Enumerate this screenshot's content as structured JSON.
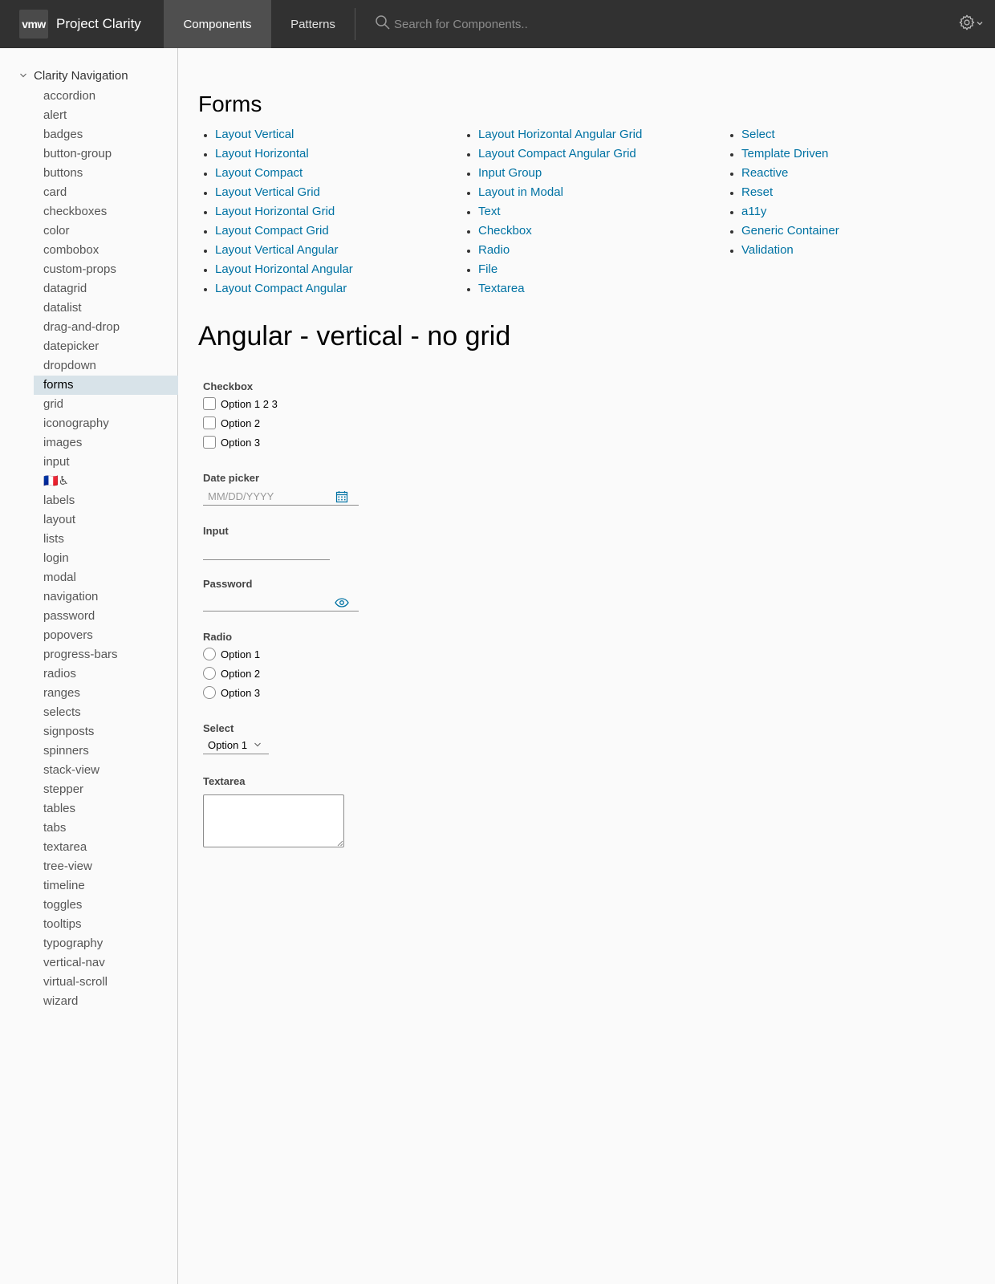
{
  "header": {
    "logo_text": "vmw",
    "app_title": "Project Clarity",
    "tabs": [
      "Components",
      "Patterns"
    ],
    "active_tab": "Components",
    "search_placeholder": "Search for Components..",
    "icons": [
      "search-icon",
      "gear-icon",
      "chevron-down-icon"
    ]
  },
  "sidebar": {
    "title": "Clarity Navigation",
    "active_item": "forms",
    "items": [
      "accordion",
      "alert",
      "badges",
      "button-group",
      "buttons",
      "card",
      "checkboxes",
      "color",
      "combobox",
      "custom-props",
      "datagrid",
      "datalist",
      "drag-and-drop",
      "datepicker",
      "dropdown",
      "forms",
      "grid",
      "iconography",
      "images",
      "input",
      "🇫🇷♿",
      "labels",
      "layout",
      "lists",
      "login",
      "modal",
      "navigation",
      "password",
      "popovers",
      "progress-bars",
      "radios",
      "ranges",
      "selects",
      "signposts",
      "spinners",
      "stack-view",
      "stepper",
      "tables",
      "tabs",
      "textarea",
      "tree-view",
      "timeline",
      "toggles",
      "tooltips",
      "typography",
      "vertical-nav",
      "virtual-scroll",
      "wizard"
    ]
  },
  "main": {
    "title": "Forms",
    "links": {
      "col1": [
        "Layout Vertical",
        "Layout Horizontal",
        "Layout Compact",
        "Layout Vertical Grid",
        "Layout Horizontal Grid",
        "Layout Compact Grid",
        "Layout Vertical Angular",
        "Layout Horizontal Angular",
        "Layout Compact Angular"
      ],
      "col2": [
        "Layout Horizontal Angular Grid",
        "Layout Compact Angular Grid",
        "Input Group",
        "Layout in Modal",
        "Text",
        "Checkbox",
        "Radio",
        "File",
        "Textarea"
      ],
      "col3": [
        "Select",
        "Template Driven",
        "Reactive",
        "Reset",
        "a11y",
        "Generic Container",
        "Validation"
      ]
    },
    "section_title": "Angular - vertical - no grid",
    "form": {
      "checkbox_label": "Checkbox",
      "checkbox_options": [
        "Option 1 2 3",
        "Option 2",
        "Option 3"
      ],
      "datepicker_label": "Date picker",
      "datepicker_placeholder": "MM/DD/YYYY",
      "input_label": "Input",
      "input_value": "",
      "password_label": "Password",
      "password_value": "",
      "radio_label": "Radio",
      "radio_options": [
        "Option 1",
        "Option 2",
        "Option 3"
      ],
      "select_label": "Select",
      "select_value": "Option 1",
      "textarea_label": "Textarea",
      "textarea_value": ""
    }
  },
  "colors": {
    "header_bg": "#313131",
    "active_tab_bg": "#4f4f4f",
    "link": "#0072a3",
    "sidebar_active_bg": "#d8e3e9",
    "page_bg": "#fafafa"
  }
}
